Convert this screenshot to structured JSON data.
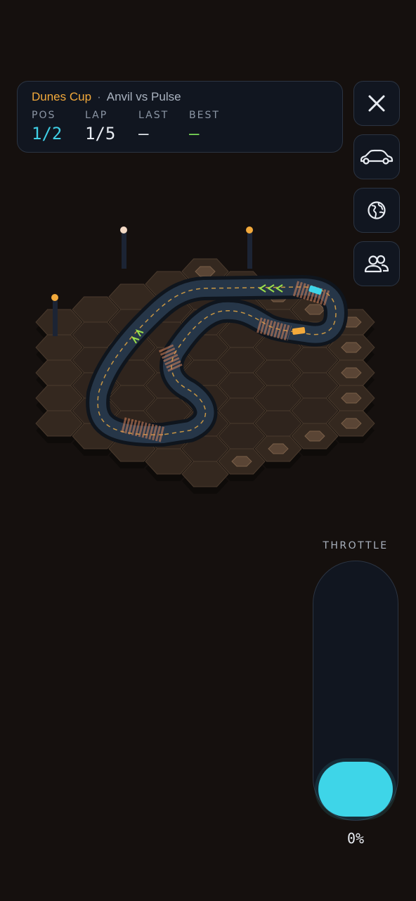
{
  "hud": {
    "cup": "Dunes Cup",
    "separator": "·",
    "matchup": "Anvil vs Pulse",
    "stats": [
      {
        "label": "POS",
        "value": "1/2"
      },
      {
        "label": "LAP",
        "value": "1/5"
      },
      {
        "label": "LAST",
        "value": "—"
      },
      {
        "label": "BEST",
        "value": "—"
      }
    ]
  },
  "side_buttons": [
    "close-icon",
    "car-icon",
    "globe-icon",
    "players-icon"
  ],
  "throttle": {
    "label": "THROTTLE",
    "level": 0,
    "value_text": "0%"
  },
  "colors": {
    "background": "#15100e",
    "panel": "#111620",
    "accent_cyan": "#3ed5e8",
    "accent_orange": "#f2a93b",
    "best_green": "#7ee35a",
    "track": "#263648",
    "tile": "#2f241d"
  }
}
